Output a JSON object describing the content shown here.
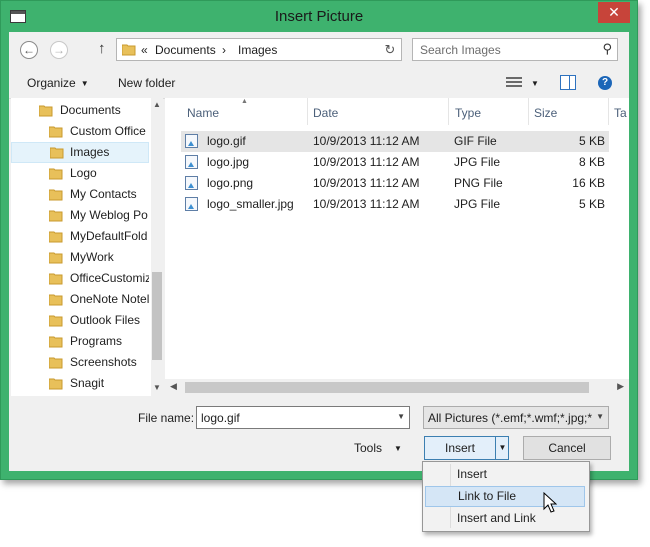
{
  "window": {
    "title": "Insert Picture",
    "close_glyph": "✕"
  },
  "nav": {
    "back_glyph": "←",
    "forward_glyph": "→",
    "up_glyph": "↑",
    "address": {
      "prefix": "«",
      "crumbs": [
        "Documents",
        "Images"
      ],
      "sep": "›"
    },
    "refresh_glyph": "↻",
    "search_placeholder": "Search Images"
  },
  "toolbar": {
    "organize_label": "Organize",
    "new_folder_label": "New folder",
    "help_glyph": "?"
  },
  "sidebar": {
    "items": [
      {
        "label": "Documents",
        "level": 0,
        "selected": false
      },
      {
        "label": "Custom Office",
        "level": 1,
        "selected": false
      },
      {
        "label": "Images",
        "level": 1,
        "selected": true
      },
      {
        "label": "Logo",
        "level": 1,
        "selected": false
      },
      {
        "label": "My Contacts",
        "level": 1,
        "selected": false
      },
      {
        "label": "My Weblog Po",
        "level": 1,
        "selected": false
      },
      {
        "label": "MyDefaultFold",
        "level": 1,
        "selected": false
      },
      {
        "label": "MyWork",
        "level": 1,
        "selected": false
      },
      {
        "label": "OfficeCustomiz",
        "level": 1,
        "selected": false
      },
      {
        "label": "OneNote Notel",
        "level": 1,
        "selected": false
      },
      {
        "label": "Outlook Files",
        "level": 1,
        "selected": false
      },
      {
        "label": "Programs",
        "level": 1,
        "selected": false
      },
      {
        "label": "Screenshots",
        "level": 1,
        "selected": false
      },
      {
        "label": "Snagit",
        "level": 1,
        "selected": false
      }
    ]
  },
  "files": {
    "columns": [
      "Name",
      "Date",
      "Type",
      "Size",
      "Ta"
    ],
    "rows": [
      {
        "name": "logo.gif",
        "date": "10/9/2013 11:12 AM",
        "type": "GIF File",
        "size": "5 KB",
        "selected": true
      },
      {
        "name": "logo.jpg",
        "date": "10/9/2013 11:12 AM",
        "type": "JPG File",
        "size": "8 KB",
        "selected": false
      },
      {
        "name": "logo.png",
        "date": "10/9/2013 11:12 AM",
        "type": "PNG File",
        "size": "16 KB",
        "selected": false
      },
      {
        "name": "logo_smaller.jpg",
        "date": "10/9/2013 11:12 AM",
        "type": "JPG File",
        "size": "5 KB",
        "selected": false
      }
    ]
  },
  "footer": {
    "file_name_label": "File name:",
    "file_name_value": "logo.gif",
    "filter_value": "All Pictures (*.emf;*.wmf;*.jpg;*",
    "tools_label": "Tools",
    "insert_label": "Insert",
    "cancel_label": "Cancel"
  },
  "insert_menu": {
    "items": [
      {
        "label": "Insert",
        "highlighted": false
      },
      {
        "label": "Link to File",
        "highlighted": true
      },
      {
        "label": "Insert and Link",
        "highlighted": false
      }
    ]
  },
  "colors": {
    "frame": "#3eb26e",
    "selection": "#e5f3fb",
    "accent": "#3c7fb1",
    "close": "#c7443a"
  }
}
